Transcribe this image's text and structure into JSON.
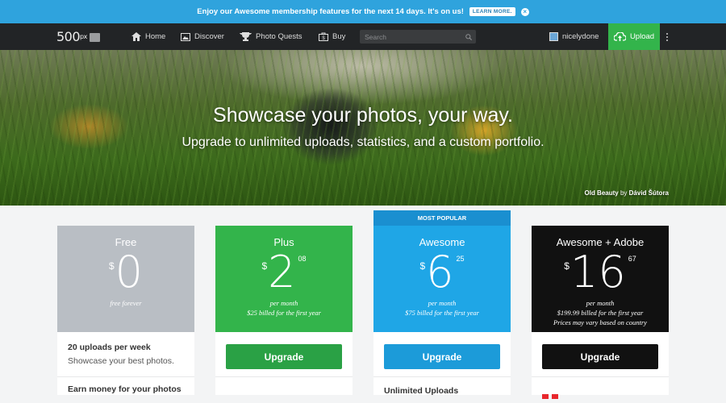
{
  "promo": {
    "text": "Enjoy our Awesome membership features for the next 14 days. It's on us!",
    "learn_more": "LEARN MORE."
  },
  "nav": {
    "logo": "500",
    "logo_sup": "px",
    "links": [
      "Home",
      "Discover",
      "Photo Quests",
      "Buy"
    ],
    "search_placeholder": "Search",
    "user": "nicelydone",
    "upload": "Upload"
  },
  "hero": {
    "title": "Showcase your photos, your way.",
    "subtitle": "Upgrade to unlimited uploads, statistics, and a custom portfolio.",
    "credit_title": "Old Beauty",
    "credit_by": "by",
    "credit_author": "Dávid Šútora"
  },
  "most_popular": "MOST POPULAR",
  "plans": [
    {
      "name": "Free",
      "currency": "$",
      "dollars": "0",
      "cents": "",
      "note1": "free forever",
      "note2": "",
      "note3": "",
      "color": "#b9bec4",
      "feature1": "20 uploads per week",
      "feature2": "Showcase your best photos.",
      "feature3": "Earn money for your photos"
    },
    {
      "name": "Plus",
      "currency": "$",
      "dollars": "2",
      "cents": "08",
      "note1": "per month",
      "note2": "$25 billed for the first year",
      "note3": "",
      "color": "#33b44b",
      "button": "Upgrade",
      "button_color": "#2aa145"
    },
    {
      "name": "Awesome",
      "currency": "$",
      "dollars": "6",
      "cents": "25",
      "note1": "per month",
      "note2": "$75 billed for the first year",
      "note3": "",
      "color": "#1fa6e6",
      "button": "Upgrade",
      "button_color": "#1c9bd9",
      "feature_stub": "Unlimited Uploads"
    },
    {
      "name": "Awesome + Adobe",
      "currency": "$",
      "dollars": "16",
      "cents": "67",
      "note1": "per month",
      "note2": "$199.99 billed for the first year",
      "note3": "Prices may vary based on country",
      "color": "#111111",
      "button": "Upgrade",
      "button_color": "#111111"
    }
  ]
}
